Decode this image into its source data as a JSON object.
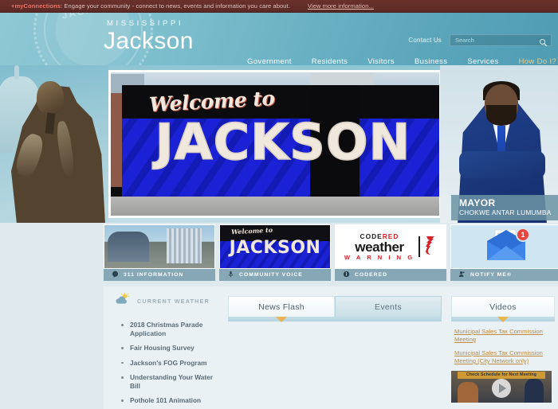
{
  "alert": {
    "brand": "+myConnections",
    "message": ": Engage your community - connect to news, events and information you care about.",
    "link": "View more information..."
  },
  "header": {
    "state": "MISSISSIPPI",
    "city": "Jackson",
    "seal_text": "CITY OF JACKSON",
    "contact": "Contact Us",
    "search_placeholder": "Search",
    "search_value": "",
    "search_icon": "search-icon",
    "nav": [
      {
        "label": "Government",
        "accent": false
      },
      {
        "label": "Residents",
        "accent": false
      },
      {
        "label": "Visitors",
        "accent": false
      },
      {
        "label": "Business",
        "accent": false
      },
      {
        "label": "Services",
        "accent": false
      },
      {
        "label": "How Do I?",
        "accent": true
      }
    ]
  },
  "hero": {
    "mural_script": "Welcome to",
    "mural_word": "JACKSON",
    "mayor_title": "MAYOR",
    "mayor_name": "CHOKWE ANTAR LUMUMBA",
    "statue_alt": "bronze statue"
  },
  "tiles": [
    {
      "label": "311 INFORMATION",
      "icon": "speech-bubble-icon",
      "art": "city-skyline"
    },
    {
      "label": "COMMUNITY VOICE",
      "icon": "microphone-icon",
      "art": "jackson-mural"
    },
    {
      "label": "CODERED",
      "icon": "info-circle-icon",
      "art": "codered-logo"
    },
    {
      "label": "NOTIFY ME®",
      "icon": "person-add-icon",
      "art": "envelope-badge"
    }
  ],
  "codered_logo": {
    "code": "CODE",
    "red": "RED",
    "weather": "weather",
    "warning": "W A R N I N G"
  },
  "notify_badge": "1",
  "sidebar": {
    "weather_label": "CURRENT WEATHER",
    "weather_icon": "sun-cloud-icon",
    "news_items": [
      "2018 Christmas Parade Application",
      "Fair Housing Survey",
      "Jackson's FOG Program",
      "Understanding Your Water Bill",
      "Pothole 101 Animation"
    ]
  },
  "tabs": [
    {
      "label": "News Flash",
      "active": true
    },
    {
      "label": "Events",
      "active": false
    }
  ],
  "videos": {
    "tab_label": "Videos",
    "links": [
      "Municipal Sales Tax Commission Meeting",
      "Municipal Sales Tax Commission Meeting (City Network only)"
    ],
    "thumb_caption": "Check Schedule for Next Meeting",
    "play_icon": "play-icon"
  },
  "colors": {
    "alert_bar": "#5b2a26",
    "header_teal": "#79bccb",
    "accent_gold": "#e5cf92",
    "link_gold": "#c08a3e",
    "codered_red": "#d81f26",
    "page_bg": "#e9f1f4"
  }
}
